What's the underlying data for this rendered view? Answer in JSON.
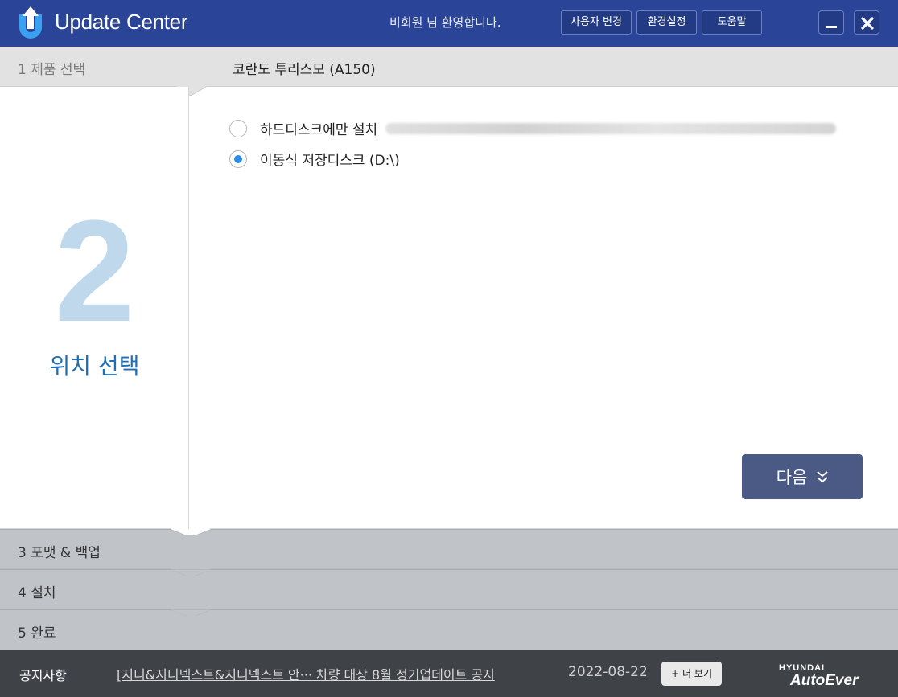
{
  "header": {
    "app_title": "Update Center",
    "welcome": "비회원  님 환영합니다.",
    "buttons": {
      "change_user": "사용자 변경",
      "settings": "환경설정",
      "help": "도움말"
    },
    "icons": {
      "logo": "update-arrow-logo",
      "minimize": "minimize-icon",
      "close": "close-icon"
    },
    "colors": {
      "titlebar": "#2a4597",
      "accent": "#1f6fb6"
    }
  },
  "steps": {
    "step1": {
      "label": "1  제품 선택",
      "value": "코란도 투리스모 (A150)"
    },
    "current": {
      "number": "2",
      "title": "위치 선택"
    },
    "step3": {
      "label": "3  포맷 & 백업"
    },
    "step4": {
      "label": "4  설치"
    },
    "step5": {
      "label": "5  완료"
    }
  },
  "options": {
    "hard_disk": {
      "label": "하드디스크에만 설치",
      "checked": false
    },
    "removable": {
      "label": "이동식 저장디스크 (D:\\)",
      "checked": true
    }
  },
  "next_button": {
    "label": "다음",
    "icon": "double-chevron-down-icon"
  },
  "footer": {
    "notice_label": "공지사항",
    "notice_text": "[지니&지니넥스트&지니넥스트  안··· 차량 대상 8월 정기업데이트 공지",
    "notice_date": "2022-08-22",
    "more_button": "+ 더 보기",
    "brand_top": "HYUNDAI",
    "brand_bottom": "AutoEver"
  }
}
